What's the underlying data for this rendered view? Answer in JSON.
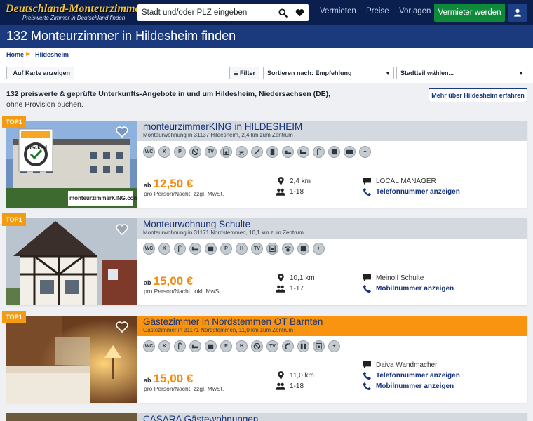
{
  "brand": {
    "name": "Deutschland-Monteurzimmer.de",
    "slogan": "Preiswerte Zimmer in Deutschland finden"
  },
  "search": {
    "placeholder": "Stadt und/oder PLZ eingeben"
  },
  "nav": {
    "items": [
      "Vermieten",
      "Preise",
      "Vorlagen"
    ],
    "cta": "Vermieter werden"
  },
  "page": {
    "title": "132 Monteurzimmer in Hildesheim finden"
  },
  "breadcrumb": [
    "Home",
    "Hildesheim"
  ],
  "filters": {
    "map_label": "Auf Karte anzeigen",
    "filter_label": "Filter",
    "sort_label": "Sortieren nach: Empfehlung",
    "district_label": "Stadtteil wählen..."
  },
  "intro": {
    "bold": "132 preiswerte & geprüfte Unterkunfts-Angebote in und um Hildesheim, Niedersachsen (DE),",
    "rest": " ohne Provision buchen.",
    "more_button": "Mehr über Hildesheim erfahren"
  },
  "colors": {
    "navy": "#0a1f4d",
    "title_blue": "#1b3a7e",
    "accent_orange": "#f49b14",
    "price_orange": "#f28c0f",
    "cta_green": "#0e8a3a"
  },
  "listings": [
    {
      "badge": "TOP1",
      "title": "monteurzimmerKING in HILDESHEIM",
      "subtitle": "Monteurwohnung in 31137 Hildesheim, 2,4 km zum Zentrum",
      "amenities": [
        "WC",
        "K",
        "P",
        "no-smoking",
        "TV",
        "washer",
        "bbq",
        "tools",
        "fridge",
        "garden",
        "bed",
        "shower",
        "lounge",
        "wifi",
        "more"
      ],
      "price_prefix": "ab",
      "price": "12,50 €",
      "price_unit": "pro Person/Nacht, zzgl. MwSt.",
      "distance": "2,4 km",
      "persons": "1-18",
      "contact_name": "LOCAL MANAGER",
      "links": [
        "Telefonnummer anzeigen"
      ],
      "photo_caption": "monteurzimmerKING.com",
      "photo_stamp": "checked"
    },
    {
      "badge": "TOP1",
      "title": "Monteurwohnung Schulte",
      "subtitle": "Monteurwohnung in 31171 Nordstemmen, 10,1 km zum Zentrum",
      "amenities": [
        "WC",
        "K",
        "shower",
        "bed",
        "kitchen",
        "P",
        "H",
        "TV",
        "washer",
        "pets",
        "garden",
        "more"
      ],
      "price_prefix": "ab",
      "price": "15,00 €",
      "price_unit": "pro Person/Nacht, inkl. MwSt.",
      "distance": "10,1 km",
      "persons": "1-17",
      "contact_name": "Meinolf Schulte",
      "links": [
        "Mobilnummer anzeigen"
      ]
    },
    {
      "badge": "TOP1",
      "title": "Gästezimmer in Nordstemmen OT Barnten",
      "subtitle": "Gästezimmer in 31171 Nordstemmen, 11,0 km zum Zentrum",
      "amenities": [
        "WC",
        "K",
        "shower",
        "bed",
        "kitchen",
        "P",
        "H",
        "no-smoking",
        "TV",
        "wifi",
        "people",
        "washer",
        "more"
      ],
      "price_prefix": "ab",
      "price": "15,00 €",
      "price_unit": "pro Person/Nacht, zzgl. MwSt.",
      "distance": "11,0 km",
      "persons": "1-18",
      "contact_name": "Daiva Wandmacher",
      "links": [
        "Telefonnummer anzeigen",
        "Mobilnummer anzeigen"
      ]
    },
    {
      "title": "CASARA Gästewohnungen"
    }
  ]
}
